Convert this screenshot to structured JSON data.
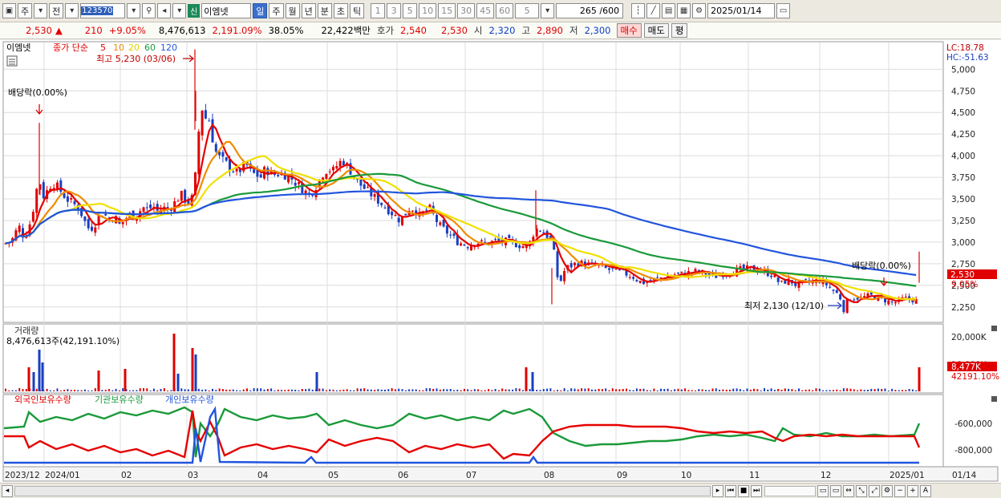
{
  "toolbar": {
    "period_main": "주",
    "prev_label": "전",
    "code": "123570",
    "stock_name": "이엠넷",
    "new_badge": "신",
    "period_tabs": [
      "일",
      "주",
      "월",
      "년",
      "분",
      "초",
      "틱"
    ],
    "selected_period": "일",
    "minute_steps": [
      "1",
      "3",
      "5",
      "10",
      "15",
      "30",
      "45",
      "60"
    ],
    "step_value": "5",
    "count": "265 /600",
    "date": "2025/01/14"
  },
  "info": {
    "price": "2,530",
    "change_arrow": "▲",
    "change": "210",
    "change_pct": "+9.05%",
    "volume": "8,476,613",
    "volume_ratio": "2,191.09%",
    "turnover": "38.05%",
    "amount": "22,422백만",
    "quote_label": "호가",
    "ask": "2,540",
    "bid": "2,530",
    "open_label": "시",
    "open": "2,320",
    "high_label": "고",
    "high": "2,890",
    "low_label": "저",
    "low": "2,300",
    "buy_label": "매수",
    "sell_label": "매도",
    "flat_label": "평"
  },
  "legend": {
    "stock": "이엠넷",
    "price_type": "종가 단순",
    "ma": [
      {
        "period": "5",
        "color": "#e60000"
      },
      {
        "period": "10",
        "color": "#f08c00"
      },
      {
        "period": "20",
        "color": "#f0e000"
      },
      {
        "period": "60",
        "color": "#1a9a3a"
      },
      {
        "period": "120",
        "color": "#2255dd"
      }
    ]
  },
  "annotations": {
    "high": "최고 5,230 (03/06)",
    "low": "최저 2,130 (12/10)",
    "ex_div_1": "배당락(0.00%)",
    "ex_div_2": "배당락(0.00%)",
    "lc": "LC:18.78",
    "hc": "HC:-51.63",
    "price_tag": "2,530",
    "pct_tag": "9.05%",
    "volume_title": "거래량",
    "volume_value": "8,476,613주(42,191.10%)",
    "vol_tag": "8,477K",
    "vol_tag2": "42191.10%",
    "holdings": [
      "외국인보유수량",
      "기관보유수량",
      "개인보유수량"
    ],
    "holding_colors": [
      "#e60000",
      "#1a9a3a",
      "#2255dd"
    ]
  },
  "chart_data": {
    "type": "candlestick",
    "price_axis": {
      "ticks": [
        "5,000",
        "4,750",
        "4,500",
        "4,250",
        "4,000",
        "3,750",
        "3,500",
        "3,250",
        "3,000",
        "2,750",
        "2,500",
        "2,250"
      ],
      "ylim": [
        2090,
        5300
      ]
    },
    "volume_axis": {
      "ticks": [
        "20,000K",
        "10,000K"
      ]
    },
    "holding_axis": {
      "ticks": [
        "-600,000",
        "-800,000"
      ]
    },
    "x_labels": [
      "2023/12",
      "2024/01",
      "02",
      "03",
      "04",
      "05",
      "06",
      "07",
      "08",
      "09",
      "10",
      "11",
      "12",
      "2025/01",
      "01/14"
    ],
    "price_path": [
      [
        0,
        2980
      ],
      [
        6,
        3000
      ],
      [
        12,
        3050
      ],
      [
        18,
        3200
      ],
      [
        25,
        3050
      ],
      [
        30,
        3150
      ],
      [
        35,
        3300
      ],
      [
        40,
        3600
      ],
      [
        46,
        3700
      ],
      [
        50,
        3500
      ],
      [
        56,
        3650
      ],
      [
        63,
        3680
      ],
      [
        70,
        3600
      ],
      [
        78,
        3500
      ],
      [
        86,
        3450
      ],
      [
        94,
        3380
      ],
      [
        100,
        3250
      ],
      [
        106,
        3150
      ],
      [
        112,
        3180
      ],
      [
        118,
        3300
      ],
      [
        124,
        3350
      ],
      [
        130,
        3250
      ],
      [
        138,
        3300
      ],
      [
        144,
        3200
      ],
      [
        150,
        3250
      ],
      [
        156,
        3320
      ],
      [
        162,
        3300
      ],
      [
        168,
        3350
      ],
      [
        174,
        3400
      ],
      [
        180,
        3380
      ],
      [
        186,
        3420
      ],
      [
        192,
        3350
      ],
      [
        198,
        3400
      ],
      [
        204,
        3380
      ],
      [
        210,
        3420
      ],
      [
        216,
        3500
      ],
      [
        222,
        3550
      ],
      [
        228,
        3450
      ],
      [
        234,
        3500
      ],
      [
        238,
        3700
      ],
      [
        242,
        4200
      ],
      [
        246,
        4600
      ],
      [
        250,
        4400
      ],
      [
        254,
        4500
      ],
      [
        258,
        4300
      ],
      [
        262,
        4100
      ],
      [
        266,
        4000
      ],
      [
        272,
        3950
      ],
      [
        278,
        3900
      ],
      [
        284,
        3850
      ],
      [
        290,
        3800
      ],
      [
        296,
        3850
      ],
      [
        302,
        3900
      ],
      [
        308,
        3800
      ],
      [
        314,
        3780
      ],
      [
        320,
        3750
      ],
      [
        326,
        3850
      ],
      [
        332,
        3800
      ],
      [
        338,
        3780
      ],
      [
        344,
        3800
      ],
      [
        350,
        3780
      ],
      [
        356,
        3760
      ],
      [
        362,
        3700
      ],
      [
        368,
        3650
      ],
      [
        374,
        3600
      ],
      [
        380,
        3550
      ],
      [
        386,
        3600
      ],
      [
        392,
        3700
      ],
      [
        398,
        3800
      ],
      [
        404,
        3850
      ],
      [
        410,
        3820
      ],
      [
        416,
        3900
      ],
      [
        422,
        3950
      ],
      [
        428,
        3880
      ],
      [
        434,
        3800
      ],
      [
        440,
        3700
      ],
      [
        446,
        3650
      ],
      [
        452,
        3600
      ],
      [
        458,
        3550
      ],
      [
        464,
        3500
      ],
      [
        470,
        3450
      ],
      [
        476,
        3400
      ],
      [
        482,
        3350
      ],
      [
        488,
        3300
      ],
      [
        494,
        3250
      ],
      [
        500,
        3320
      ],
      [
        506,
        3400
      ],
      [
        512,
        3380
      ],
      [
        518,
        3300
      ],
      [
        524,
        3350
      ],
      [
        530,
        3400
      ],
      [
        536,
        3300
      ],
      [
        542,
        3200
      ],
      [
        548,
        3150
      ],
      [
        554,
        3100
      ],
      [
        560,
        3050
      ],
      [
        566,
        3000
      ],
      [
        572,
        2980
      ],
      [
        578,
        2960
      ],
      [
        584,
        2980
      ],
      [
        590,
        3000
      ],
      [
        596,
        2990
      ],
      [
        602,
        2980
      ],
      [
        608,
        3000
      ],
      [
        614,
        3020
      ],
      [
        620,
        3000
      ],
      [
        626,
        3010
      ],
      [
        632,
        3000
      ],
      [
        638,
        2980
      ],
      [
        644,
        2960
      ],
      [
        650,
        2950
      ],
      [
        656,
        3000
      ],
      [
        660,
        3100
      ],
      [
        664,
        3150
      ],
      [
        668,
        3150
      ],
      [
        674,
        3100
      ],
      [
        680,
        3050
      ],
      [
        684,
        3000
      ],
      [
        688,
        2700
      ],
      [
        692,
        2500
      ],
      [
        696,
        2600
      ],
      [
        700,
        2700
      ],
      [
        706,
        2720
      ],
      [
        712,
        2750
      ],
      [
        718,
        2760
      ],
      [
        724,
        2750
      ],
      [
        730,
        2740
      ],
      [
        736,
        2730
      ],
      [
        742,
        2720
      ],
      [
        748,
        2700
      ],
      [
        754,
        2680
      ],
      [
        760,
        2680
      ],
      [
        766,
        2660
      ],
      [
        772,
        2650
      ],
      [
        778,
        2620
      ],
      [
        784,
        2600
      ],
      [
        790,
        2560
      ],
      [
        796,
        2530
      ],
      [
        802,
        2540
      ],
      [
        808,
        2560
      ],
      [
        814,
        2580
      ],
      [
        820,
        2590
      ],
      [
        826,
        2600
      ],
      [
        832,
        2620
      ],
      [
        838,
        2630
      ],
      [
        844,
        2630
      ],
      [
        850,
        2640
      ],
      [
        856,
        2650
      ],
      [
        862,
        2660
      ],
      [
        868,
        2650
      ],
      [
        874,
        2640
      ],
      [
        880,
        2620
      ],
      [
        886,
        2600
      ],
      [
        892,
        2620
      ],
      [
        898,
        2640
      ],
      [
        904,
        2650
      ],
      [
        910,
        2670
      ],
      [
        916,
        2680
      ],
      [
        922,
        2690
      ],
      [
        928,
        2690
      ],
      [
        934,
        2690
      ],
      [
        940,
        2680
      ],
      [
        946,
        2660
      ],
      [
        952,
        2640
      ],
      [
        958,
        2620
      ],
      [
        964,
        2550
      ],
      [
        970,
        2520
      ],
      [
        976,
        2560
      ],
      [
        982,
        2540
      ],
      [
        988,
        2500
      ],
      [
        994,
        2520
      ],
      [
        1000,
        2540
      ],
      [
        1006,
        2530
      ],
      [
        1012,
        2550
      ],
      [
        1018,
        2560
      ],
      [
        1024,
        2520
      ],
      [
        1030,
        2470
      ],
      [
        1036,
        2420
      ],
      [
        1042,
        2380
      ],
      [
        1046,
        2200
      ],
      [
        1050,
        2300
      ],
      [
        1056,
        2350
      ],
      [
        1062,
        2360
      ],
      [
        1068,
        2350
      ],
      [
        1074,
        2370
      ],
      [
        1080,
        2380
      ],
      [
        1086,
        2370
      ],
      [
        1092,
        2350
      ],
      [
        1098,
        2330
      ],
      [
        1104,
        2310
      ],
      [
        1110,
        2300
      ],
      [
        1116,
        2320
      ],
      [
        1122,
        2350
      ],
      [
        1128,
        2340
      ],
      [
        1134,
        2330
      ],
      [
        1140,
        2320
      ],
      [
        1146,
        2530
      ]
    ]
  }
}
